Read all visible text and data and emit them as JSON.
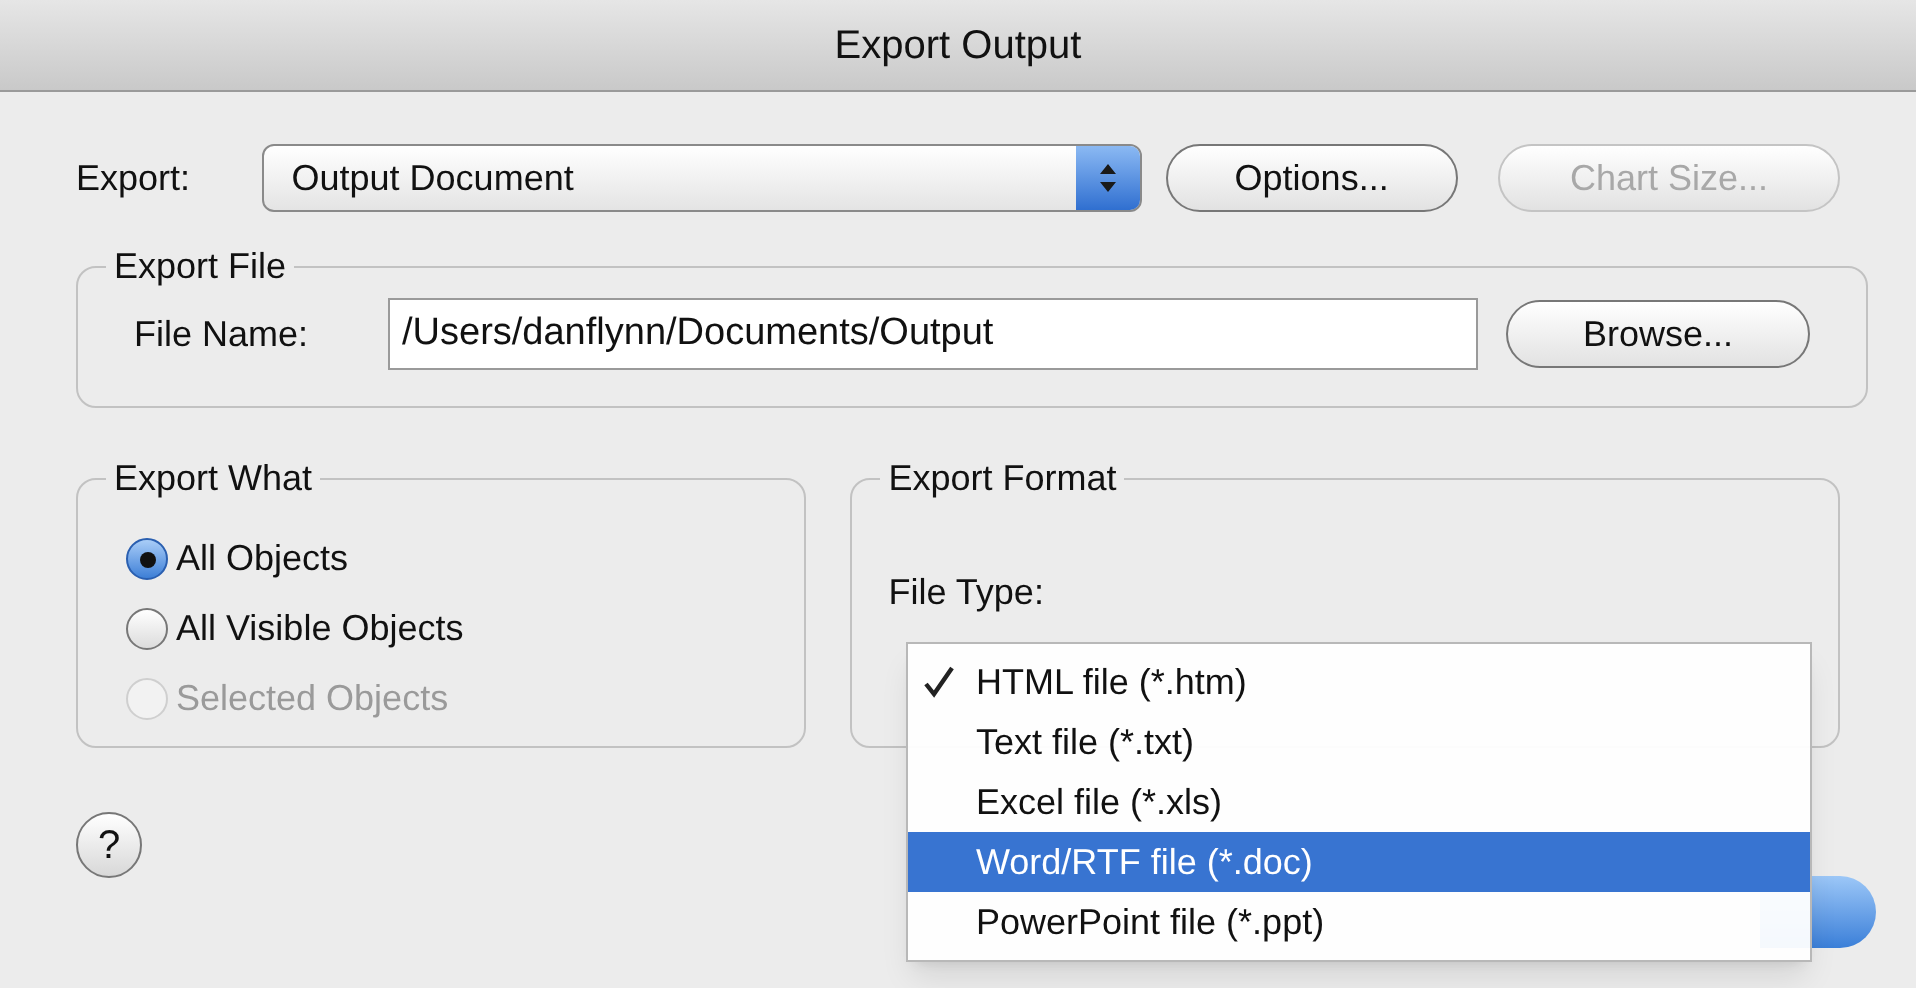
{
  "window": {
    "title": "Export Output"
  },
  "export": {
    "label": "Export:",
    "value": "Output Document"
  },
  "buttons": [
    {
      "label": "Options...",
      "disabled": false
    },
    {
      "label": "Chart Size...",
      "disabled": true
    }
  ],
  "export_file": {
    "title": "Export File",
    "file_name": {
      "label": "File Name:",
      "value": "/Users/danflynn/Documents/Output"
    },
    "browse_button": "Browse..."
  },
  "export_what": {
    "title": "Export What",
    "options": [
      {
        "label": "All Objects",
        "selected": true,
        "disabled": false
      },
      {
        "label": "All Visible Objects",
        "selected": false,
        "disabled": false
      },
      {
        "label": "Selected Objects",
        "selected": false,
        "disabled": true
      }
    ]
  },
  "export_format": {
    "title": "Export Format",
    "file_type_label": "File Type:",
    "menu": [
      {
        "label": "HTML file (*.htm)",
        "checked": true,
        "highlighted": false
      },
      {
        "label": "Text file (*.txt)",
        "checked": false,
        "highlighted": false
      },
      {
        "label": "Excel file (*.xls)",
        "checked": false,
        "highlighted": false
      },
      {
        "label": "Word/RTF file (*.doc)",
        "checked": false,
        "highlighted": true
      },
      {
        "label": "PowerPoint file (*.ppt)",
        "checked": false,
        "highlighted": false
      }
    ]
  },
  "help_button": "?"
}
